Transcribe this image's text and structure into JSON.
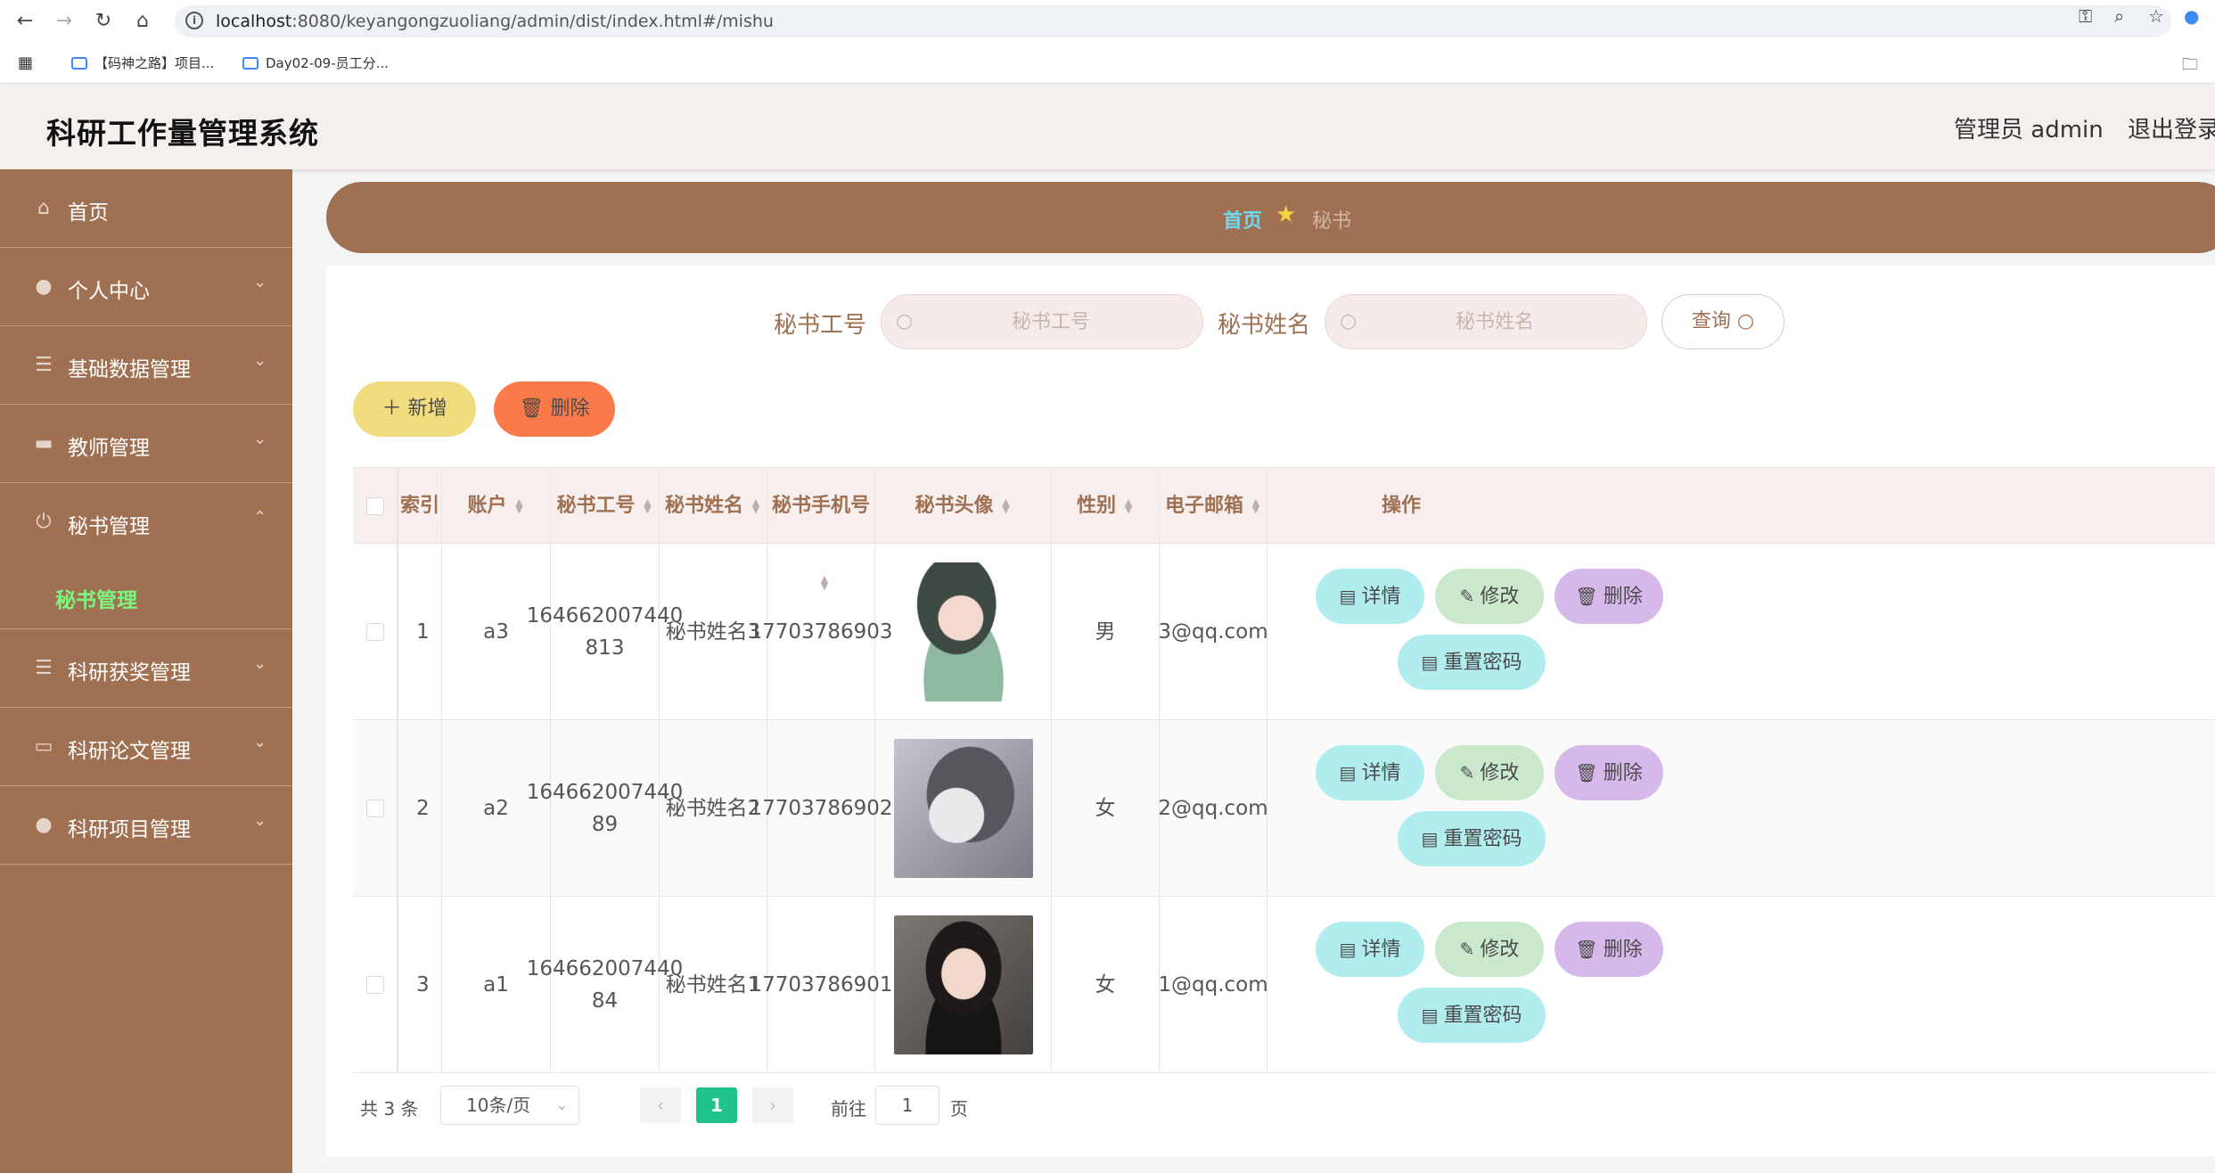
{
  "browser": {
    "url_host": "localhost",
    "url_rest": ":8080/keyangongzuoliang/admin/dist/index.html#/mishu",
    "bookmarks": [
      "【码神之路】项目...",
      "Day02-09-员工分..."
    ]
  },
  "header": {
    "title": "科研工作量管理系统",
    "admin": "管理员 admin",
    "logout": "退出登录"
  },
  "sidebar": {
    "items": [
      {
        "label": "首页",
        "icon": "home-icon"
      },
      {
        "label": "个人中心",
        "icon": "user-icon"
      },
      {
        "label": "基础数据管理",
        "icon": "sliders-icon"
      },
      {
        "label": "教师管理",
        "icon": "ticket-icon"
      },
      {
        "label": "秘书管理",
        "icon": "power-icon"
      },
      {
        "label": "科研获奖管理",
        "icon": "list-icon"
      },
      {
        "label": "科研论文管理",
        "icon": "monitor-icon"
      },
      {
        "label": "科研项目管理",
        "icon": "bulb-icon"
      }
    ],
    "sub_active": "秘书管理"
  },
  "breadcrumb": {
    "home": "首页",
    "current": "秘书"
  },
  "search": {
    "label1": "秘书工号",
    "placeholder1": "秘书工号",
    "label2": "秘书姓名",
    "placeholder2": "秘书姓名",
    "query": "查询"
  },
  "actions": {
    "add": "新增",
    "delete": "删除"
  },
  "table": {
    "headers": [
      "索引",
      "账户",
      "秘书工号",
      "秘书姓名",
      "秘书手机号",
      "秘书头像",
      "性别",
      "电子邮箱",
      "操作"
    ],
    "rows": [
      {
        "index": "1",
        "account": "a3",
        "id_line1": "164662007440",
        "id_line2": "813",
        "name": "秘书姓名3",
        "phone": "17703786903",
        "gender": "男",
        "email": "3@qq.com"
      },
      {
        "index": "2",
        "account": "a2",
        "id_line1": "164662007440",
        "id_line2": "89",
        "name": "秘书姓名2",
        "phone": "17703786902",
        "gender": "女",
        "email": "2@qq.com"
      },
      {
        "index": "3",
        "account": "a1",
        "id_line1": "164662007440",
        "id_line2": "84",
        "name": "秘书姓名1",
        "phone": "17703786901",
        "gender": "女",
        "email": "1@qq.com"
      }
    ],
    "ops": {
      "detail": "详情",
      "edit": "修改",
      "delete": "删除",
      "reset": "重置密码"
    }
  },
  "pagination": {
    "total": "共 3 条",
    "page_size": "10条/页",
    "current": "1",
    "goto": "前往",
    "goto_value": "1",
    "unit": "页"
  }
}
